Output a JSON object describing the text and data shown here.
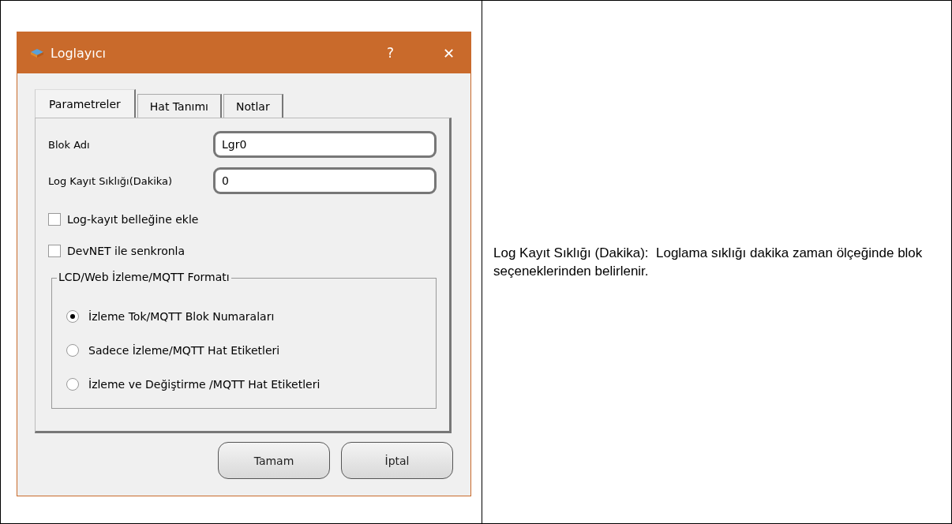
{
  "window": {
    "title": "Loglayıcı",
    "help": "?",
    "close": "✕"
  },
  "tabs": [
    {
      "label": "Parametreler",
      "selected": true
    },
    {
      "label": "Hat Tanımı",
      "selected": false
    },
    {
      "label": "Notlar",
      "selected": false
    }
  ],
  "fields": [
    {
      "label": "Blok Adı",
      "value": "Lgr0"
    },
    {
      "label": "Log Kayıt Sıklığı(Dakika)",
      "value": "0"
    }
  ],
  "checkboxes": [
    {
      "label": "Log-kayıt belleğine ekle",
      "checked": false
    },
    {
      "label": "DevNET ile senkronla",
      "checked": false
    }
  ],
  "group": {
    "title": "LCD/Web İzleme/MQTT Formatı",
    "options": [
      {
        "label": "İzleme Tok/MQTT Blok Numaraları",
        "selected": true
      },
      {
        "label": "Sadece İzleme/MQTT Hat Etiketleri",
        "selected": false
      },
      {
        "label": "İzleme ve Değiştirme /MQTT Hat Etiketleri",
        "selected": false
      }
    ]
  },
  "buttons": [
    "Tamam",
    "İptal"
  ],
  "description": "Log Kayıt Sıklığı (Dakika):  Loglama sıklığı dakika zaman ölçeğinde blok seçeneklerinden belirlenir."
}
